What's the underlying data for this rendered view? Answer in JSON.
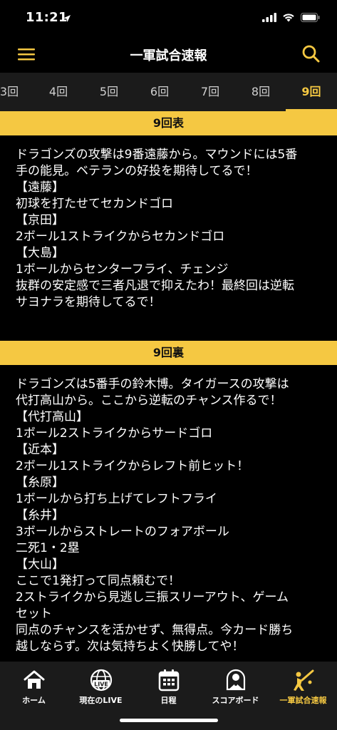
{
  "status_bar": {
    "time": "11:21"
  },
  "header": {
    "title": "一軍試合速報"
  },
  "tabs": [
    {
      "label": "3回"
    },
    {
      "label": "4回"
    },
    {
      "label": "5回"
    },
    {
      "label": "6回"
    },
    {
      "label": "7回"
    },
    {
      "label": "8回"
    },
    {
      "label": "9回"
    }
  ],
  "active_tab": "9回",
  "innings": [
    {
      "title": "9回表",
      "lines": [
        "ドラゴンズの攻撃は9番遠藤から。マウンドには5番",
        "手の能見。ベテランの好投を期待してるで！",
        "【遠藤】",
        "初球を打たせてセカンドゴロ",
        "【京田】",
        "2ボール1ストライクからセカンドゴロ",
        "【大島】",
        "1ボールからセンターフライ、チェンジ",
        "抜群の安定感で三者凡退で抑えたわ！最終回は逆転",
        "サヨナラを期待してるで！"
      ]
    },
    {
      "title": "9回裏",
      "lines": [
        "ドラゴンズは5番手の鈴木博。タイガースの攻撃は",
        "代打高山から。ここから逆転のチャンス作るで！",
        "【代打高山】",
        "1ボール2ストライクからサードゴロ",
        "【近本】",
        "2ボール1ストライクからレフト前ヒット！",
        "【糸原】",
        "1ボールから打ち上げてレフトフライ",
        "【糸井】",
        "3ボールからストレートのフォアボール",
        "二死1・2塁",
        "【大山】",
        "ここで1発打って同点頼むで！",
        "2ストライクから見逃し三振スリーアウト、ゲーム",
        "セット",
        "同点のチャンスを活かせず、無得点。今カード勝ち",
        "越しならず。次は気持ちよく快勝してや！"
      ]
    }
  ],
  "tabbar": {
    "items": [
      {
        "label": "ホーム",
        "icon": "home-icon"
      },
      {
        "label": "現在のLIVE",
        "icon": "live-icon"
      },
      {
        "label": "日程",
        "icon": "calendar-icon"
      },
      {
        "label": "スコアボード",
        "icon": "scoreboard-icon"
      },
      {
        "label": "一軍試合速報",
        "icon": "batter-icon"
      }
    ],
    "active": "一軍試合速報"
  },
  "colors": {
    "accent": "#f5c842",
    "background": "#000000",
    "tab_background": "#1b1b1b"
  }
}
